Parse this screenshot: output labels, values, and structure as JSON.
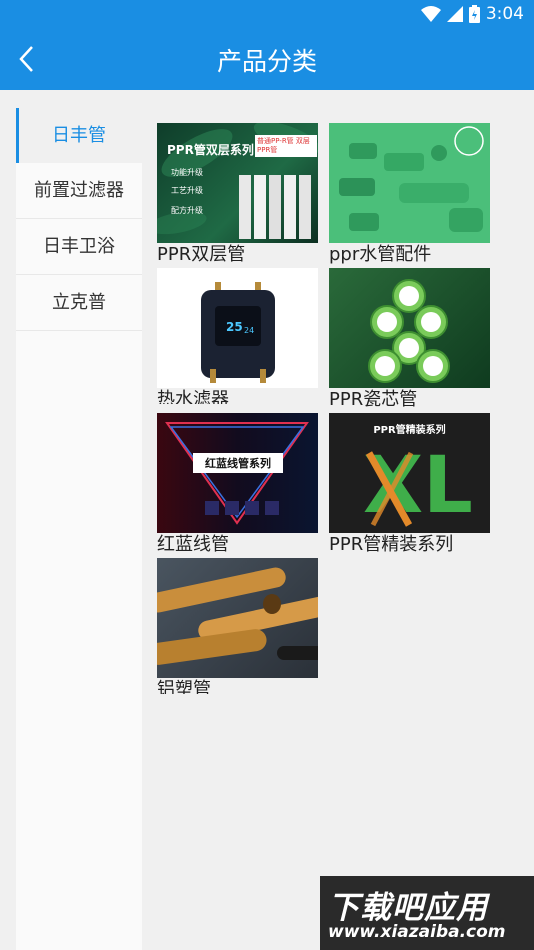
{
  "status": {
    "time": "3:04"
  },
  "header": {
    "title": "产品分类"
  },
  "sidebar": {
    "items": [
      {
        "label": "日丰管",
        "active": true
      },
      {
        "label": "前置过滤器",
        "active": false
      },
      {
        "label": "日丰卫浴",
        "active": false
      },
      {
        "label": "立克普",
        "active": false
      }
    ]
  },
  "products": [
    {
      "label": "PPR双层管",
      "img_text": "PPR管双层系列",
      "img_sub": "普通PP-R管 双层PPR管",
      "img_lines": [
        "功能升级",
        "工艺升级",
        "配方升级"
      ]
    },
    {
      "label": "ppr水管配件"
    },
    {
      "label": "热水滤器",
      "display_text": "25",
      "display_sub": "24"
    },
    {
      "label": "PPR瓷芯管"
    },
    {
      "label": "红蓝线管",
      "img_text": "红蓝线管系列"
    },
    {
      "label": "PPR管精装系列",
      "img_text": "PPR管精装系列",
      "img_big": "XL"
    },
    {
      "label": "铝塑管"
    }
  ],
  "watermark": {
    "line1": "下载吧应用",
    "line2": "www.xiazaiba.com"
  }
}
